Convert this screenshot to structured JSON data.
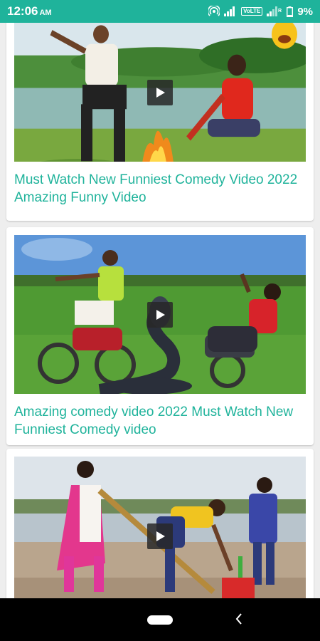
{
  "status_bar": {
    "time": "12:06",
    "ampm": "AM",
    "lte_label": "VoLTE",
    "battery": "9%"
  },
  "videos": [
    {
      "title": "Must Watch New Funniest Comedy Video 2022 Amazing Funny Video"
    },
    {
      "title": "Amazing comedy video 2022 Must Watch New Funniest Comedy video"
    },
    {
      "title": ""
    }
  ],
  "colors": {
    "accent": "#1fb39b",
    "status_bar": "#1fb39b",
    "nav_bar": "#000000"
  },
  "icons": {
    "play": "play-icon",
    "back": "back-icon",
    "home": "home-icon"
  }
}
